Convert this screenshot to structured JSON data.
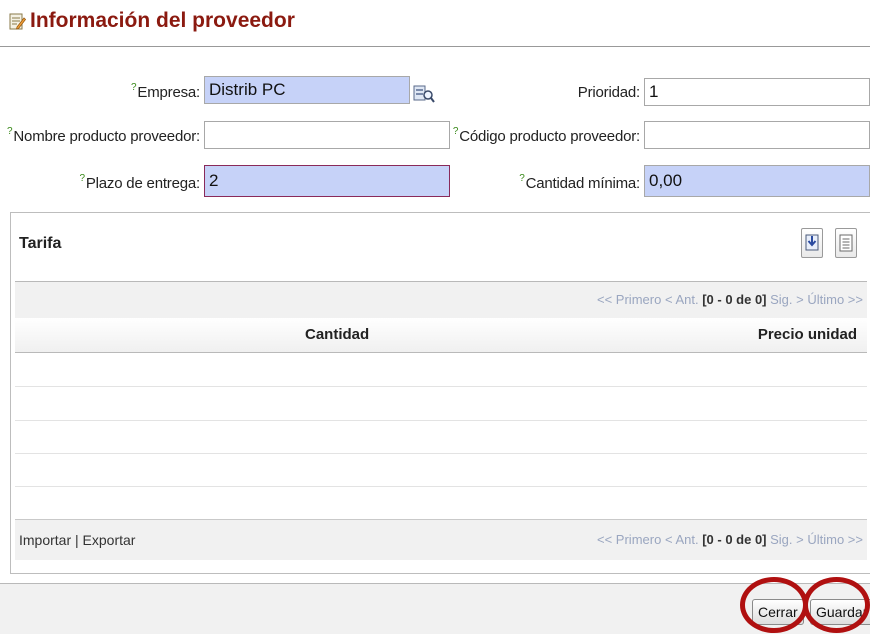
{
  "header": {
    "title": "Información del proveedor",
    "icon": "edit-document-icon"
  },
  "form": {
    "empresa": {
      "label": "Empresa:",
      "value": "Distrib PC"
    },
    "prioridad": {
      "label": "Prioridad:",
      "value": "1"
    },
    "nombre_producto": {
      "label": "Nombre producto proveedor:",
      "value": ""
    },
    "codigo_producto": {
      "label": "Código producto proveedor:",
      "value": ""
    },
    "plazo_entrega": {
      "label": "Plazo de entrega:",
      "value": "2"
    },
    "cantidad_minima": {
      "label": "Cantidad mínima:",
      "value": "0,00"
    },
    "help_marker": "?"
  },
  "tarifa": {
    "title": "Tarifa",
    "pager": {
      "first": "<< Primero",
      "prev": "< Ant.",
      "range": "[0 - 0 de 0]",
      "next": "Sig. >",
      "last": "Último >>"
    },
    "columns": [
      "Cantidad",
      "Precio unidad"
    ],
    "import_label": "Importar",
    "separator": "|",
    "export_label": "Exportar"
  },
  "footer": {
    "close_label": "Cerrar",
    "save_label": "Guardar"
  },
  "colors": {
    "title": "#8b1a10",
    "required_field": "#c6d2f8",
    "annotation": "#b01010"
  }
}
